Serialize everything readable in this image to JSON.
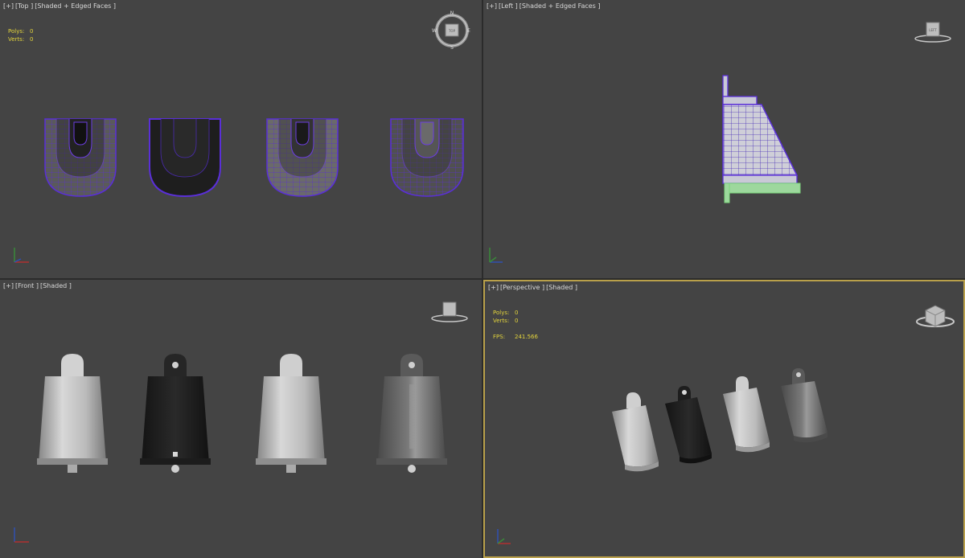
{
  "viewports": {
    "top": {
      "label_plus": "[+]",
      "label_view": "[Top ]",
      "label_mode": "[Shaded + Edged Faces ]",
      "polys_label": "Polys:",
      "polys_value": "0",
      "verts_label": "Verts:",
      "verts_value": "0",
      "compass": {
        "n": "N",
        "s": "S",
        "e": "E",
        "w": "W",
        "cube": "TOP"
      }
    },
    "left": {
      "label_plus": "[+]",
      "label_view": "[Left ]",
      "label_mode": "[Shaded + Edged Faces ]",
      "cube": "LEFT"
    },
    "front": {
      "label_plus": "[+]",
      "label_view": "[Front ]",
      "label_mode": "[Shaded ]"
    },
    "perspective": {
      "label_plus": "[+]",
      "label_view": "[Perspective ]",
      "label_mode": "[Shaded ]",
      "polys_label": "Polys:",
      "polys_value": "0",
      "verts_label": "Verts:",
      "verts_value": "0",
      "fps_label": "FPS:",
      "fps_value": "241.566"
    }
  },
  "colors": {
    "viewport_bg": "#444444",
    "active_border": "#b9a04a",
    "stats_text": "#e3d43c",
    "wire": "#6a3bd6",
    "selected_green": "#7cd67c"
  }
}
